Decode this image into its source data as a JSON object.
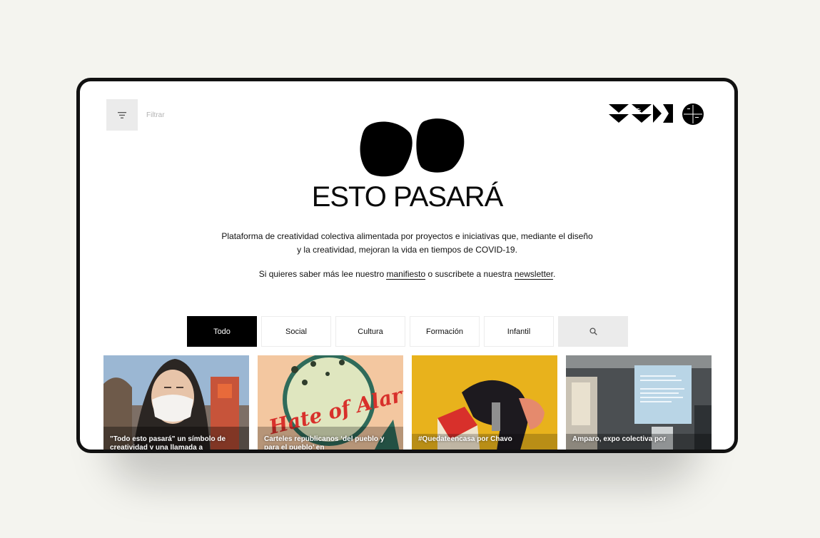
{
  "header": {
    "filter_label": "Filtrar",
    "filter_icon": "filter-lines-icon",
    "partner_logos": [
      "valencia-design-logo",
      "circle-logo"
    ]
  },
  "hero": {
    "title": "ESTO PASARÁ",
    "description": "Plataforma de creatividad colectiva alimentada por proyectos e iniciativas que, mediante el diseño y la creatividad, mejoran la vida en tiempos de COVID-19.",
    "cta_prefix": "Si quieres saber más lee nuestro ",
    "cta_link1": "manifiesto",
    "cta_middle": " o suscribete a nuestra ",
    "cta_link2": "newsletter",
    "cta_suffix": "."
  },
  "tabs": [
    {
      "label": "Todo",
      "active": true
    },
    {
      "label": "Social",
      "active": false
    },
    {
      "label": "Cultura",
      "active": false
    },
    {
      "label": "Formación",
      "active": false
    },
    {
      "label": "Infantil",
      "active": false
    }
  ],
  "search_icon": "search-icon",
  "cards": [
    {
      "caption": "\"Todo esto pasará\" un símbolo de creatividad y una llamada a"
    },
    {
      "caption": "Carteles republicanos ‘del pueblo y para el pueblo’ en"
    },
    {
      "caption": "#Quedateencasa por Chavo"
    },
    {
      "caption": "Amparo, expo colectiva por"
    }
  ],
  "card2_art_text": "Hate of Alarm!",
  "colors": {
    "active_tab": "#000000",
    "search_tab": "#ebebeb",
    "card3_bg": "#e8b21c",
    "card2_bg": "#f3c7a0"
  }
}
